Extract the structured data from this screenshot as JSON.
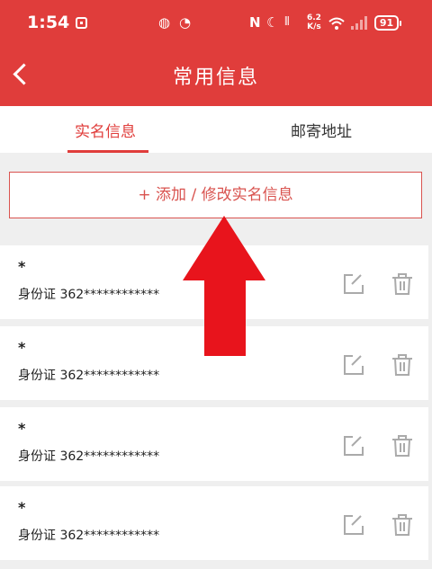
{
  "status_bar": {
    "time": "1:54",
    "speed_value": "6.2",
    "speed_unit": "K/s",
    "battery": "91"
  },
  "header": {
    "title": "常用信息"
  },
  "tabs": [
    {
      "label": "实名信息",
      "active": true
    },
    {
      "label": "邮寄地址",
      "active": false
    }
  ],
  "add_button_label": "+ 添加 / 修改实名信息",
  "records": [
    {
      "name": "*",
      "id_label": "身份证 362************"
    },
    {
      "name": "*",
      "id_label": "身份证 362************"
    },
    {
      "name": "*",
      "id_label": "身份证 362************"
    },
    {
      "name": "*",
      "id_label": "身份证 362************"
    }
  ],
  "icons": {
    "back": "chevron-left-icon",
    "edit": "edit-icon",
    "delete": "trash-icon",
    "overlay": "red-up-arrow"
  },
  "colors": {
    "brand": "#e03d3b",
    "background": "#efefef"
  }
}
